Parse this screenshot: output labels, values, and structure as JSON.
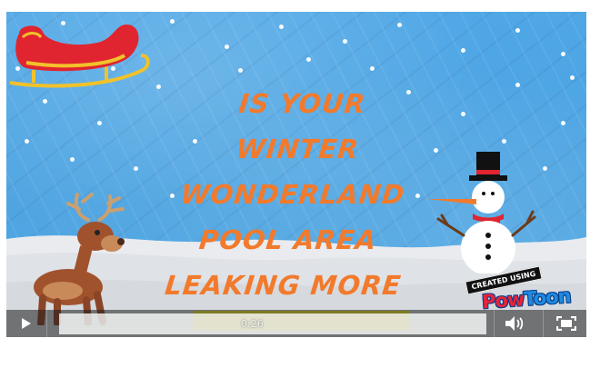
{
  "video": {
    "title_lines": [
      "IS YOUR",
      "WINTER",
      "WONDERLAND",
      "POOL AREA",
      "LEAKING MORE"
    ],
    "watermark": {
      "created_label": "CREATED USING",
      "brand_part1": "Pow",
      "brand_part2": "Toon"
    }
  },
  "controls": {
    "current_time": "0:26",
    "progress_fraction": 0.0
  },
  "colors": {
    "sky": "#4fa7e6",
    "title": "#f27a2c",
    "highlight": "#f4ec1a",
    "snow": "#ffffff"
  },
  "icons": {
    "play": "play-icon",
    "volume": "volume-icon",
    "fullscreen": "fullscreen-icon"
  }
}
